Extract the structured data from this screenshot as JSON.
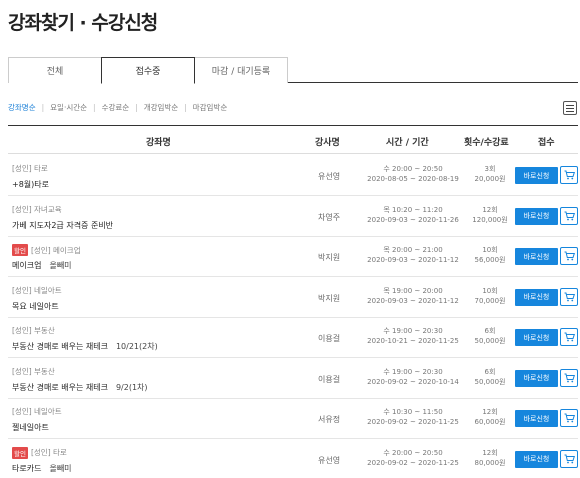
{
  "page_title": "강좌찾기 · 수강신청",
  "tabs": [
    {
      "label": "전체"
    },
    {
      "label": "접수중"
    },
    {
      "label": "마감 / 대기등록"
    }
  ],
  "sorts": [
    "강좌명순",
    "요일·시간순",
    "수강료순",
    "개강임박순",
    "마감임박순"
  ],
  "header": {
    "col_name": "강좌명",
    "col_instructor": "강사명",
    "col_time": "시간 / 기간",
    "col_fee": "횟수/수강료",
    "col_apply": "접수"
  },
  "apply_label": "바로신청",
  "hot_badge": "할인",
  "colors": {
    "accent": "#1686dd",
    "badge": "#e34b4b"
  },
  "courses": [
    {
      "category": "[성인] 타로",
      "name": "+8월)타로",
      "extra": "",
      "instructor": "유선영",
      "time": "수 20:00 ~ 20:50",
      "period": "2020-08-05 ~ 2020-08-19",
      "sessions": "3회",
      "fee": "20,000원",
      "hot": false
    },
    {
      "category": "[성인] 자녀교육",
      "name": "가베 지도자2급 자격증 준비반",
      "extra": "",
      "instructor": "차영주",
      "time": "목 10:20 ~ 11:20",
      "period": "2020-09-03 ~ 2020-11-26",
      "sessions": "12회",
      "fee": "120,000원",
      "hot": false
    },
    {
      "category": "[성인] 메이크업",
      "name": "메이크업",
      "extra": "올빼미",
      "instructor": "박지원",
      "time": "목 20:00 ~ 21:00",
      "period": "2020-09-03 ~ 2020-11-12",
      "sessions": "10회",
      "fee": "56,000원",
      "hot": true
    },
    {
      "category": "[성인] 네일아트",
      "name": "목요 네일아트",
      "extra": "",
      "instructor": "박지원",
      "time": "목 19:00 ~ 20:00",
      "period": "2020-09-03 ~ 2020-11-12",
      "sessions": "10회",
      "fee": "70,000원",
      "hot": false
    },
    {
      "category": "[성인] 부동산",
      "name": "부동산 경매로 배우는 재테크",
      "extra": "10/21(2차)",
      "instructor": "이용걸",
      "time": "수 19:00 ~ 20:30",
      "period": "2020-10-21 ~ 2020-11-25",
      "sessions": "6회",
      "fee": "50,000원",
      "hot": false
    },
    {
      "category": "[성인] 부동산",
      "name": "부동산 경매로 배우는 재테크",
      "extra": "9/2(1차)",
      "instructor": "이용걸",
      "time": "수 19:00 ~ 20:30",
      "period": "2020-09-02 ~ 2020-10-14",
      "sessions": "6회",
      "fee": "50,000원",
      "hot": false
    },
    {
      "category": "[성인] 네일아트",
      "name": "젤네일아트",
      "extra": "",
      "instructor": "서유정",
      "time": "수 10:30 ~ 11:50",
      "period": "2020-09-02 ~ 2020-11-25",
      "sessions": "12회",
      "fee": "60,000원",
      "hot": false
    },
    {
      "category": "[성인] 타로",
      "name": "타로카드",
      "extra": "올빼미",
      "instructor": "유선영",
      "time": "수 20:00 ~ 20:50",
      "period": "2020-09-02 ~ 2020-11-25",
      "sessions": "12회",
      "fee": "80,000원",
      "hot": true
    }
  ]
}
